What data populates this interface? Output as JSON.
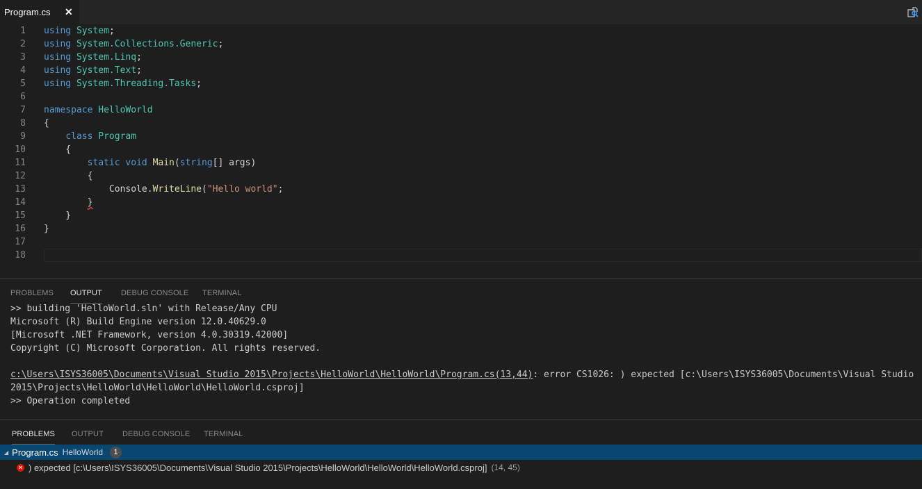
{
  "tabs": [
    {
      "label": "Program.cs",
      "active": true,
      "close_icon": "close-icon"
    }
  ],
  "tab_actions": {
    "icon": "open-preview-icon"
  },
  "editor": {
    "lines": [
      {
        "n": "1",
        "tokens": [
          [
            "kw",
            "using"
          ],
          [
            "pl",
            " "
          ],
          [
            "ty",
            "System"
          ],
          [
            "pl",
            ";"
          ]
        ]
      },
      {
        "n": "2",
        "tokens": [
          [
            "kw",
            "using"
          ],
          [
            "pl",
            " "
          ],
          [
            "ty",
            "System.Collections.Generic"
          ],
          [
            "pl",
            ";"
          ]
        ]
      },
      {
        "n": "3",
        "tokens": [
          [
            "kw",
            "using"
          ],
          [
            "pl",
            " "
          ],
          [
            "ty",
            "System.Linq"
          ],
          [
            "pl",
            ";"
          ]
        ]
      },
      {
        "n": "4",
        "tokens": [
          [
            "kw",
            "using"
          ],
          [
            "pl",
            " "
          ],
          [
            "ty",
            "System.Text"
          ],
          [
            "pl",
            ";"
          ]
        ]
      },
      {
        "n": "5",
        "tokens": [
          [
            "kw",
            "using"
          ],
          [
            "pl",
            " "
          ],
          [
            "ty",
            "System.Threading.Tasks"
          ],
          [
            "pl",
            ";"
          ]
        ]
      },
      {
        "n": "6",
        "tokens": []
      },
      {
        "n": "7",
        "tokens": [
          [
            "kw",
            "namespace"
          ],
          [
            "pl",
            " "
          ],
          [
            "ty",
            "HelloWorld"
          ]
        ]
      },
      {
        "n": "8",
        "tokens": [
          [
            "pl",
            "{"
          ]
        ]
      },
      {
        "n": "9",
        "tokens": [
          [
            "pl",
            "    "
          ],
          [
            "kw",
            "class"
          ],
          [
            "pl",
            " "
          ],
          [
            "ty",
            "Program"
          ]
        ]
      },
      {
        "n": "10",
        "tokens": [
          [
            "pl",
            "    {"
          ]
        ]
      },
      {
        "n": "11",
        "tokens": [
          [
            "pl",
            "        "
          ],
          [
            "kw",
            "static"
          ],
          [
            "pl",
            " "
          ],
          [
            "kw",
            "void"
          ],
          [
            "pl",
            " "
          ],
          [
            "fn",
            "Main"
          ],
          [
            "pl",
            "("
          ],
          [
            "kw",
            "string"
          ],
          [
            "pl",
            "[] args)"
          ]
        ]
      },
      {
        "n": "12",
        "tokens": [
          [
            "pl",
            "        {"
          ]
        ]
      },
      {
        "n": "13",
        "tokens": [
          [
            "pl",
            "            "
          ],
          [
            "va",
            "Console"
          ],
          [
            "pl",
            "."
          ],
          [
            "fn",
            "WriteLine"
          ],
          [
            "pl",
            "("
          ],
          [
            "st",
            "\"Hello world\""
          ],
          [
            "pl",
            ";"
          ]
        ]
      },
      {
        "n": "14",
        "tokens": [
          [
            "pl",
            "        "
          ],
          [
            "sq",
            "}"
          ]
        ]
      },
      {
        "n": "15",
        "tokens": [
          [
            "pl",
            "    }"
          ]
        ]
      },
      {
        "n": "16",
        "tokens": [
          [
            "pl",
            "}"
          ]
        ]
      },
      {
        "n": "17",
        "tokens": []
      },
      {
        "n": "18",
        "tokens": [],
        "current": true
      }
    ]
  },
  "output_panel": {
    "tabs": [
      {
        "label": "PROBLEMS",
        "active": false
      },
      {
        "label": "OUTPUT",
        "active": true
      },
      {
        "label": "DEBUG CONSOLE",
        "active": false
      },
      {
        "label": "TERMINAL",
        "active": false
      }
    ],
    "lines": [
      ">> building 'HelloWorld.sln' with Release/Any CPU",
      "Microsoft (R) Build Engine version 12.0.40629.0",
      "[Microsoft .NET Framework, version 4.0.30319.42000]",
      "Copyright (C) Microsoft Corporation. All rights reserved.",
      ""
    ],
    "error_link": "c:\\Users\\ISYS36005\\Documents\\Visual Studio 2015\\Projects\\HelloWorld\\HelloWorld\\Program.cs(13,44)",
    "error_rest": ": error CS1026: ) expected [c:\\Users\\ISYS36005\\Documents\\Visual Studio",
    "error_cont": "2015\\Projects\\HelloWorld\\HelloWorld\\HelloWorld.csproj]",
    "final_line": ">> Operation completed"
  },
  "problems_panel": {
    "tabs": [
      {
        "label": "PROBLEMS",
        "active": true
      },
      {
        "label": "OUTPUT",
        "active": false
      },
      {
        "label": "DEBUG CONSOLE",
        "active": false
      },
      {
        "label": "TERMINAL",
        "active": false
      }
    ],
    "file": {
      "name": "Program.cs",
      "folder": "HelloWorld",
      "count": "1"
    },
    "items": [
      {
        "severity": "error",
        "message": ") expected [c:\\Users\\ISYS36005\\Documents\\Visual Studio 2015\\Projects\\HelloWorld\\HelloWorld\\HelloWorld.csproj]",
        "location": "(14, 45)"
      }
    ]
  },
  "colors": {
    "keyword": "#569cd6",
    "type": "#4ec9b0",
    "function": "#dcdcaa",
    "string": "#ce9178",
    "selection": "#094771",
    "error": "#e51400"
  }
}
